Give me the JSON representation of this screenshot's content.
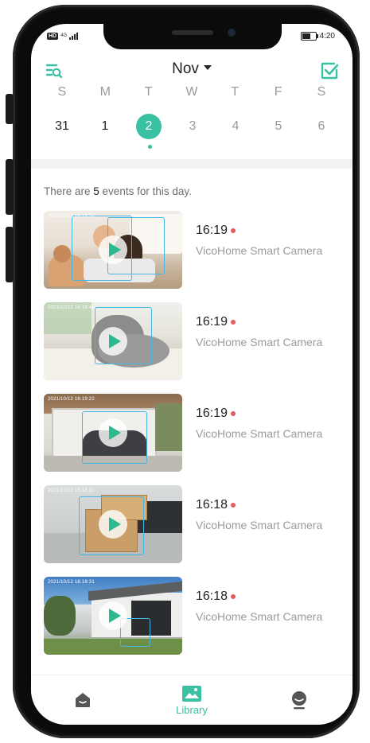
{
  "status_bar": {
    "hd": "HD",
    "network": "4G",
    "time": "4:20"
  },
  "header": {
    "month": "Nov",
    "filter_icon": "search-filter-icon",
    "select_icon": "checkbox-edit-icon"
  },
  "calendar": {
    "weekdays": [
      "S",
      "M",
      "T",
      "W",
      "T",
      "F",
      "S"
    ],
    "dates": [
      "31",
      "1",
      "2",
      "3",
      "4",
      "5",
      "6"
    ],
    "selected": "2"
  },
  "summary": {
    "prefix": "There are ",
    "count": "5",
    "suffix": " events for this day."
  },
  "events": [
    {
      "time": "16:19",
      "camera": "VicoHome Smart Camera",
      "timestamp": "2021/10/12 16:19:50"
    },
    {
      "time": "16:19",
      "camera": "VicoHome Smart Camera",
      "timestamp": "2021/10/12 16:19:42"
    },
    {
      "time": "16:19",
      "camera": "VicoHome Smart Camera",
      "timestamp": "2021/10/12 16:19:22"
    },
    {
      "time": "16:18",
      "camera": "VicoHome Smart Camera",
      "timestamp": "2021/10/12 16:18:31"
    },
    {
      "time": "16:18",
      "camera": "VicoHome Smart Camera",
      "timestamp": "2021/10/12 16:18:31"
    }
  ],
  "tabbar": {
    "home_icon": "home-icon",
    "library_label": "Library",
    "library_icon": "library-image-icon",
    "profile_icon": "profile-face-icon"
  },
  "colors": {
    "accent": "#3ac0a3",
    "record_dot": "#e35b5b",
    "detection_box": "#46b6e6"
  }
}
